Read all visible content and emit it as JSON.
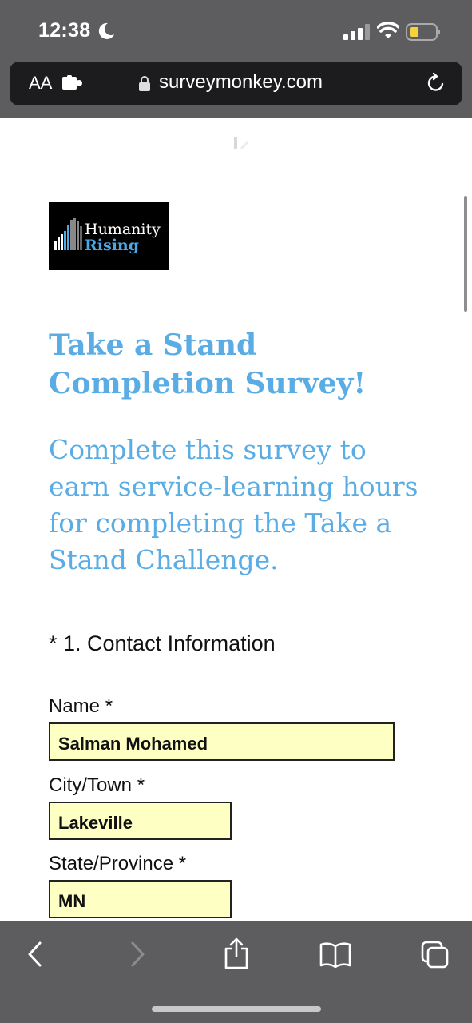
{
  "status": {
    "time": "12:38"
  },
  "browser": {
    "aa_label": "AA",
    "url": "surveymonkey.com"
  },
  "logo": {
    "line1": "Humanity",
    "line2": "Rising"
  },
  "survey": {
    "title": "Take a Stand Completion Survey!",
    "subtitle": "Complete this survey to earn service-learning hours for completing the Take a Stand Challenge.",
    "question": "* 1. Contact Information",
    "fields": [
      {
        "label": "Name *",
        "value": "Salman Mohamed"
      },
      {
        "label": "City/Town *",
        "value": "Lakeville"
      },
      {
        "label": "State/Province *",
        "value": "MN"
      }
    ]
  },
  "colors": {
    "accent": "#5aace5",
    "field_bg": "#fdffc3",
    "chrome": "#5d5d5f"
  },
  "toolbar_icons": [
    "back-icon",
    "forward-icon",
    "share-icon",
    "bookmarks-icon",
    "tabs-icon"
  ]
}
